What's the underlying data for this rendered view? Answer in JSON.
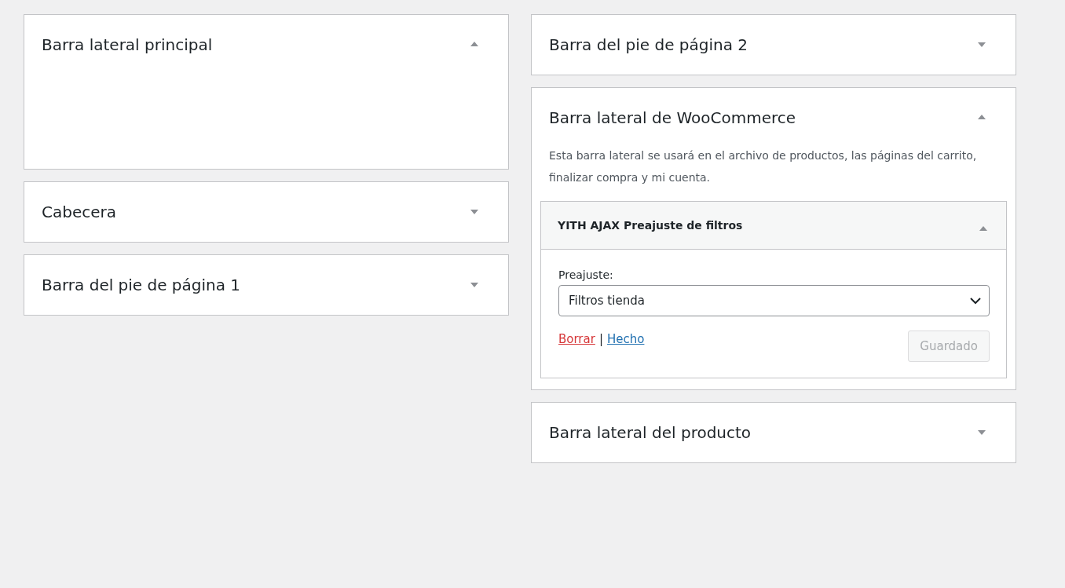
{
  "columns": [
    {
      "areas": [
        {
          "title": "Barra lateral principal",
          "expanded": true
        },
        {
          "title": "Cabecera",
          "expanded": false
        },
        {
          "title": "Barra del pie de página 1",
          "expanded": false
        }
      ]
    },
    {
      "areas": [
        {
          "title": "Barra del pie de página 2",
          "expanded": false
        },
        {
          "title": "Barra lateral de WooCommerce",
          "expanded": true,
          "description": "Esta barra lateral se usará en el archivo de productos, las páginas del carrito, finalizar compra y mi cuenta.",
          "widgets": [
            {
              "title": "YITH AJAX Preajuste de filtros",
              "expanded": true,
              "field_label": "Preajuste:",
              "select_value": "Filtros tienda",
              "delete_link": "Borrar",
              "separator": "|",
              "done_link": "Hecho",
              "save_button": {
                "label": "Guardado",
                "disabled": true
              }
            }
          ]
        },
        {
          "title": "Barra lateral del producto",
          "expanded": false
        }
      ]
    }
  ]
}
